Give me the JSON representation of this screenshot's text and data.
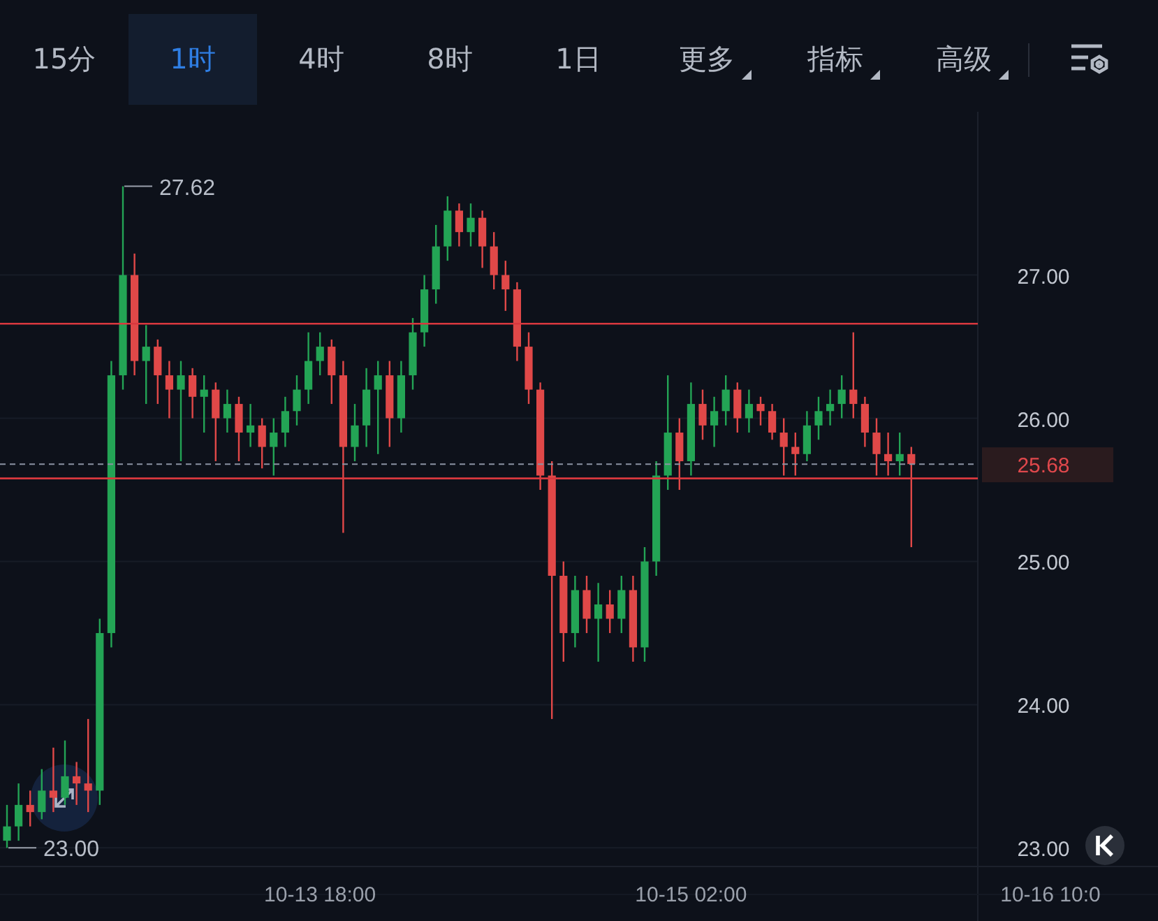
{
  "toolbar": {
    "tabs": [
      {
        "label": "15分",
        "selected": false,
        "kind": "plain"
      },
      {
        "label": "1时",
        "selected": true,
        "kind": "plain"
      },
      {
        "label": "4时",
        "selected": false,
        "kind": "plain"
      },
      {
        "label": "8时",
        "selected": false,
        "kind": "plain"
      },
      {
        "label": "1日",
        "selected": false,
        "kind": "plain"
      },
      {
        "label": "更多",
        "selected": false,
        "kind": "menu"
      },
      {
        "label": "指标",
        "selected": false,
        "kind": "menu"
      },
      {
        "label": "高级",
        "selected": false,
        "kind": "menu"
      }
    ]
  },
  "chart": {
    "chart_data": {
      "type": "candlestick",
      "grid": true,
      "ylim": [
        22.87,
        28.14
      ],
      "yticks": [
        {
          "value": 27,
          "label": "27.00"
        },
        {
          "value": 26,
          "label": "26.00"
        },
        {
          "value": 25,
          "label": "25.00"
        },
        {
          "value": 24,
          "label": "24.00"
        },
        {
          "value": 23,
          "label": "23.00"
        }
      ],
      "categories": [
        null,
        null,
        null,
        null,
        null,
        null,
        null,
        null,
        null,
        null,
        null,
        null,
        null,
        null,
        null,
        null,
        null,
        null,
        null,
        null,
        null,
        null,
        null,
        null,
        null,
        null,
        null,
        "10-13 18:00",
        null,
        null,
        null,
        null,
        null,
        null,
        null,
        null,
        null,
        null,
        null,
        null,
        null,
        null,
        null,
        null,
        null,
        null,
        null,
        null,
        null,
        null,
        null,
        null,
        null,
        null,
        null,
        null,
        null,
        null,
        null,
        "10-15 02:00",
        null,
        null,
        null,
        null,
        null,
        null,
        null,
        null,
        null,
        null,
        null,
        null,
        null,
        null,
        null,
        null,
        null,
        null,
        null,
        null,
        null,
        null,
        null,
        null,
        null,
        null,
        null,
        null,
        null,
        null,
        "10-16 10:0"
      ],
      "ohlc": [
        [
          23.05,
          23.3,
          23.0,
          23.15
        ],
        [
          23.15,
          23.45,
          23.05,
          23.3
        ],
        [
          23.3,
          23.4,
          23.15,
          23.25
        ],
        [
          23.25,
          23.55,
          23.2,
          23.4
        ],
        [
          23.4,
          23.7,
          23.25,
          23.35
        ],
        [
          23.35,
          23.75,
          23.3,
          23.5
        ],
        [
          23.5,
          23.6,
          23.3,
          23.45
        ],
        [
          23.45,
          23.9,
          23.25,
          23.4
        ],
        [
          23.4,
          24.6,
          23.3,
          24.5
        ],
        [
          24.5,
          26.4,
          24.4,
          26.3
        ],
        [
          26.3,
          27.62,
          26.2,
          27.0
        ],
        [
          27.0,
          27.15,
          26.3,
          26.4
        ],
        [
          26.4,
          26.65,
          26.1,
          26.5
        ],
        [
          26.5,
          26.55,
          26.1,
          26.3
        ],
        [
          26.3,
          26.4,
          26.0,
          26.2
        ],
        [
          26.2,
          26.4,
          25.7,
          26.3
        ],
        [
          26.3,
          26.35,
          26.0,
          26.15
        ],
        [
          26.15,
          26.3,
          25.9,
          26.2
        ],
        [
          26.2,
          26.25,
          25.7,
          26.0
        ],
        [
          26.0,
          26.2,
          25.9,
          26.1
        ],
        [
          26.1,
          26.15,
          25.7,
          25.9
        ],
        [
          25.9,
          26.1,
          25.8,
          25.95
        ],
        [
          25.95,
          26.0,
          25.65,
          25.8
        ],
        [
          25.8,
          26.0,
          25.6,
          25.9
        ],
        [
          25.9,
          26.15,
          25.8,
          26.05
        ],
        [
          26.05,
          26.3,
          25.95,
          26.2
        ],
        [
          26.2,
          26.6,
          26.1,
          26.4
        ],
        [
          26.4,
          26.6,
          26.3,
          26.5
        ],
        [
          26.5,
          26.55,
          26.1,
          26.3
        ],
        [
          26.3,
          26.4,
          25.2,
          25.8
        ],
        [
          25.8,
          26.1,
          25.7,
          25.95
        ],
        [
          25.95,
          26.35,
          25.8,
          26.2
        ],
        [
          26.2,
          26.4,
          25.75,
          26.3
        ],
        [
          26.3,
          26.4,
          25.8,
          26.0
        ],
        [
          26.0,
          26.4,
          25.9,
          26.3
        ],
        [
          26.3,
          26.7,
          26.2,
          26.6
        ],
        [
          26.6,
          27.0,
          26.5,
          26.9
        ],
        [
          26.9,
          27.35,
          26.8,
          27.2
        ],
        [
          27.2,
          27.55,
          27.1,
          27.45
        ],
        [
          27.45,
          27.5,
          27.2,
          27.3
        ],
        [
          27.3,
          27.5,
          27.2,
          27.4
        ],
        [
          27.4,
          27.45,
          27.05,
          27.2
        ],
        [
          27.2,
          27.3,
          26.9,
          27.0
        ],
        [
          27.0,
          27.1,
          26.75,
          26.9
        ],
        [
          26.9,
          26.95,
          26.4,
          26.5
        ],
        [
          26.5,
          26.6,
          26.1,
          26.2
        ],
        [
          26.2,
          26.25,
          25.5,
          25.6
        ],
        [
          25.6,
          25.7,
          23.9,
          24.9
        ],
        [
          24.9,
          25.0,
          24.3,
          24.5
        ],
        [
          24.5,
          24.9,
          24.4,
          24.8
        ],
        [
          24.8,
          24.9,
          24.5,
          24.6
        ],
        [
          24.6,
          24.85,
          24.3,
          24.7
        ],
        [
          24.7,
          24.8,
          24.5,
          24.6
        ],
        [
          24.6,
          24.9,
          24.5,
          24.8
        ],
        [
          24.8,
          24.9,
          24.3,
          24.4
        ],
        [
          24.4,
          25.1,
          24.3,
          25.0
        ],
        [
          25.0,
          25.7,
          24.9,
          25.6
        ],
        [
          25.6,
          26.3,
          25.5,
          25.9
        ],
        [
          25.9,
          26.0,
          25.5,
          25.7
        ],
        [
          25.7,
          26.25,
          25.6,
          26.1
        ],
        [
          26.1,
          26.2,
          25.85,
          25.95
        ],
        [
          25.95,
          26.15,
          25.8,
          26.05
        ],
        [
          26.05,
          26.3,
          25.95,
          26.2
        ],
        [
          26.2,
          26.25,
          25.9,
          26.0
        ],
        [
          26.0,
          26.2,
          25.9,
          26.1
        ],
        [
          26.1,
          26.15,
          25.95,
          26.05
        ],
        [
          26.05,
          26.1,
          25.85,
          25.9
        ],
        [
          25.9,
          26.0,
          25.6,
          25.8
        ],
        [
          25.8,
          25.9,
          25.6,
          25.75
        ],
        [
          25.75,
          26.05,
          25.7,
          25.95
        ],
        [
          25.95,
          26.15,
          25.85,
          26.05
        ],
        [
          26.05,
          26.2,
          25.95,
          26.1
        ],
        [
          26.1,
          26.3,
          26.0,
          26.2
        ],
        [
          26.2,
          26.6,
          26.0,
          26.1
        ],
        [
          26.1,
          26.15,
          25.8,
          25.9
        ],
        [
          25.9,
          26.0,
          25.6,
          25.75
        ],
        [
          25.75,
          25.9,
          25.6,
          25.7
        ],
        [
          25.7,
          25.9,
          25.6,
          25.75
        ],
        [
          25.75,
          25.8,
          25.1,
          25.68
        ],
        null,
        null,
        null,
        null,
        null,
        null,
        null,
        null,
        null,
        null,
        null,
        null
      ],
      "ref_lines": [
        {
          "value": 26.66,
          "axis": "y"
        },
        {
          "value": 25.58,
          "axis": "y"
        },
        {
          "value": 25.68,
          "axis": "y",
          "label": "25.68"
        }
      ],
      "annotations": [
        "27.62",
        "23.00"
      ]
    }
  }
}
